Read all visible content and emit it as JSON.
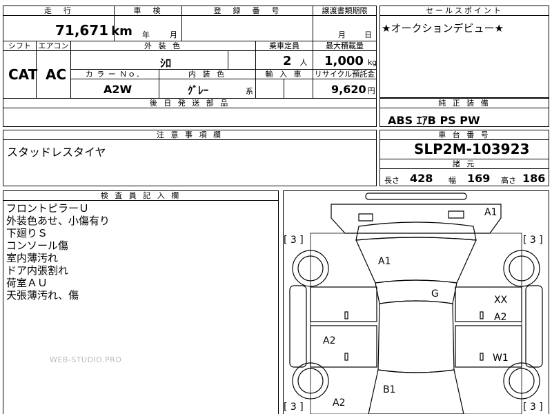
{
  "header": {
    "mileage_label": "走　行",
    "inspection_label": "車　検",
    "registration_label": "登　録　番　号",
    "transfer_label": "譲渡書類期限",
    "sales_point_label": "セールスポイント",
    "mileage_value": "71,671",
    "mileage_unit": "km",
    "insp_year": "年",
    "insp_month": "月",
    "transfer_month": "月",
    "transfer_day": "日"
  },
  "spec": {
    "shift_label": "シフト",
    "ac_label": "エアコン",
    "exterior_label": "外 装 色",
    "capacity_label": "乗車定員",
    "max_load_label": "最大積載量",
    "shift_value": "CAT",
    "ac_value": "AC",
    "exterior_value": "ｼﾛ",
    "capacity_value": "2",
    "capacity_unit": "人",
    "max_load_value": "1,000",
    "max_load_unit": "kg",
    "color_no_label": "カ ラ ー Ｎｏ．",
    "interior_label": "内 装 色",
    "import_label": "輸 入 車",
    "recycle_label": "リサイクル預託金",
    "color_no_value": "A2W",
    "interior_value": "ｸﾞﾚｰ",
    "interior_suffix": "系",
    "recycle_value": "9,620",
    "recycle_unit": "円",
    "later_parts_label": "後 日 発 送 部 品"
  },
  "sales_point": {
    "text": "★オークションデビュー★"
  },
  "equipment": {
    "label": "純 正 装 備",
    "value": "ABS ｴｱB PS PW"
  },
  "notes": {
    "label": "注 意 事 項 欄",
    "text": "スタッドレスタイヤ"
  },
  "chassis": {
    "label": "車 台 番 号",
    "value": "SLP2M-103923",
    "dims_label": "諸 元",
    "length_label": "長さ",
    "length_value": "428",
    "width_label": "幅",
    "width_value": "169",
    "height_label": "高さ",
    "height_value": "186"
  },
  "inspector": {
    "label": "検 査 員 記 入 欄",
    "lines": [
      "フロントピラーＵ",
      "外装色あせ、小傷有り",
      "下廻りＳ",
      "コンソール傷",
      "室内薄汚れ",
      "ドア内張割れ",
      "荷室ＡＵ",
      "天張薄汚れ、傷"
    ]
  },
  "diagram": {
    "tire_front_left": "[ 3 ]",
    "tire_front_right": "[ 3 ]",
    "tire_rear_left": "[ 3 ]",
    "tire_rear_right": "[ 3 ]",
    "marks": {
      "front": "A1",
      "hood": "A1",
      "roof": "G",
      "right_front_1": "XX",
      "right_front_2": "A2",
      "left_door": "A2",
      "right_rear": "W1",
      "rear_center": "B1",
      "rear_left": "A2"
    }
  },
  "watermark": "WEB-STUDIO.PRO"
}
